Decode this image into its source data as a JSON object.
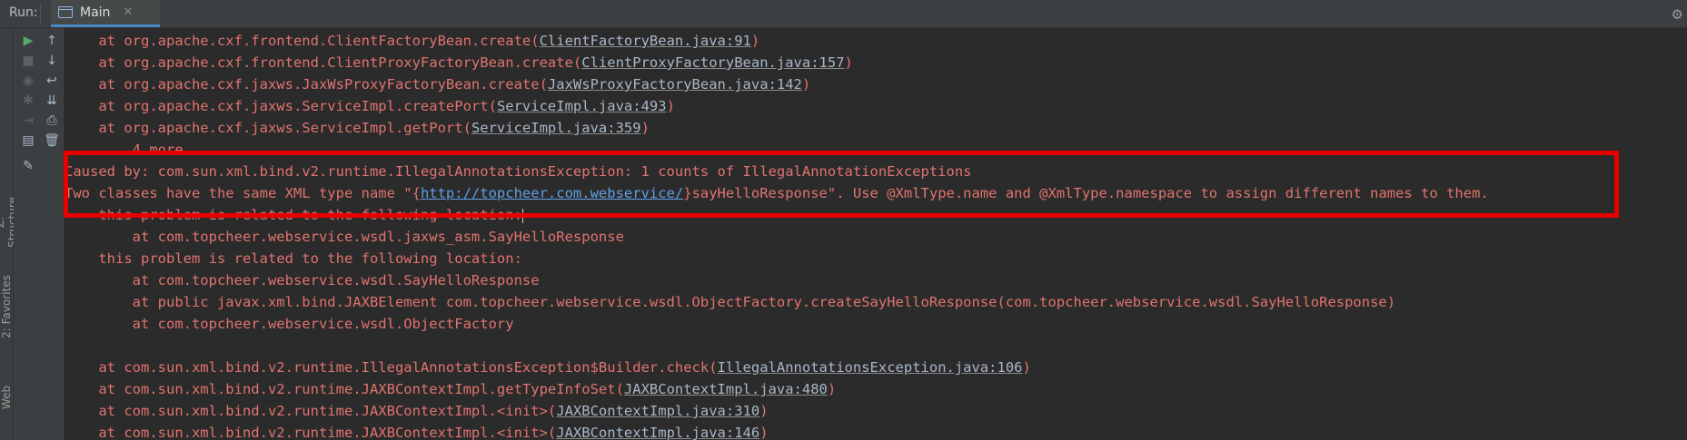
{
  "window": {
    "run_label": "Run:",
    "tab_label": "Main"
  },
  "colors": {
    "error_text": "#e0736f",
    "link": "#5f9fe6",
    "highlight": "#e60000",
    "accent": "#4a88c7"
  },
  "sidebar": {
    "structure_label": "Z: Structure",
    "favorites_label": "2: Favorites",
    "web_label": "Web"
  },
  "console": {
    "lines": [
      {
        "indent": "    ",
        "pre": "at org.apache.cxf.frontend.ClientFactoryBean.create(",
        "link": "ClientFactoryBean.java:91",
        "post": ")"
      },
      {
        "indent": "    ",
        "pre": "at org.apache.cxf.frontend.ClientProxyFactoryBean.create(",
        "link": "ClientProxyFactoryBean.java:157",
        "post": ")"
      },
      {
        "indent": "    ",
        "pre": "at org.apache.cxf.jaxws.JaxWsProxyFactoryBean.create(",
        "link": "JaxWsProxyFactoryBean.java:142",
        "post": ")"
      },
      {
        "indent": "    ",
        "pre": "at org.apache.cxf.jaxws.ServiceImpl.createPort(",
        "link": "ServiceImpl.java:493",
        "post": ")"
      },
      {
        "indent": "    ",
        "pre": "at org.apache.cxf.jaxws.ServiceImpl.getPort(",
        "link": "ServiceImpl.java:359",
        "post": ")"
      },
      {
        "indent": "    ",
        "pre": "... 4 more",
        "link": "",
        "post": ""
      },
      {
        "indent": "",
        "pre": "Caused by: com.sun.xml.bind.v2.runtime.IllegalAnnotationsException: 1 counts of IllegalAnnotationExceptions",
        "link": "",
        "post": ""
      },
      {
        "indent": "",
        "pre": "Two classes have the same XML type name \"{",
        "url": "http://topcheer.com.webservice/",
        "post": "}sayHelloResponse\". Use @XmlType.name and @XmlType.namespace to assign different names to them."
      },
      {
        "indent": "    ",
        "pre": "this problem is related to the following location:",
        "link": "",
        "post": ""
      },
      {
        "indent": "        ",
        "pre": "at com.topcheer.webservice.wsdl.jaxws_asm.SayHelloResponse",
        "link": "",
        "post": ""
      },
      {
        "indent": "    ",
        "pre": "this problem is related to the following location:",
        "link": "",
        "post": ""
      },
      {
        "indent": "        ",
        "pre": "at com.topcheer.webservice.wsdl.SayHelloResponse",
        "link": "",
        "post": ""
      },
      {
        "indent": "        ",
        "pre": "at public javax.xml.bind.JAXBElement com.topcheer.webservice.wsdl.ObjectFactory.createSayHelloResponse(com.topcheer.webservice.wsdl.SayHelloResponse)",
        "link": "",
        "post": ""
      },
      {
        "indent": "        ",
        "pre": "at com.topcheer.webservice.wsdl.ObjectFactory",
        "link": "",
        "post": ""
      },
      {
        "indent": "",
        "pre": "",
        "link": "",
        "post": ""
      },
      {
        "indent": "    ",
        "pre": "at com.sun.xml.bind.v2.runtime.IllegalAnnotationsException$Builder.check(",
        "link": "IllegalAnnotationsException.java:106",
        "post": ")"
      },
      {
        "indent": "    ",
        "pre": "at com.sun.xml.bind.v2.runtime.JAXBContextImpl.getTypeInfoSet(",
        "link": "JAXBContextImpl.java:480",
        "post": ")"
      },
      {
        "indent": "    ",
        "pre": "at com.sun.xml.bind.v2.runtime.JAXBContextImpl.<init>(",
        "link": "JAXBContextImpl.java:310",
        "post": ")"
      },
      {
        "indent": "    ",
        "pre": "at com.sun.xml.bind.v2.runtime.JAXBContextImpl.<init>(",
        "link": "JAXBContextImpl.java:146",
        "post": ")"
      }
    ]
  }
}
